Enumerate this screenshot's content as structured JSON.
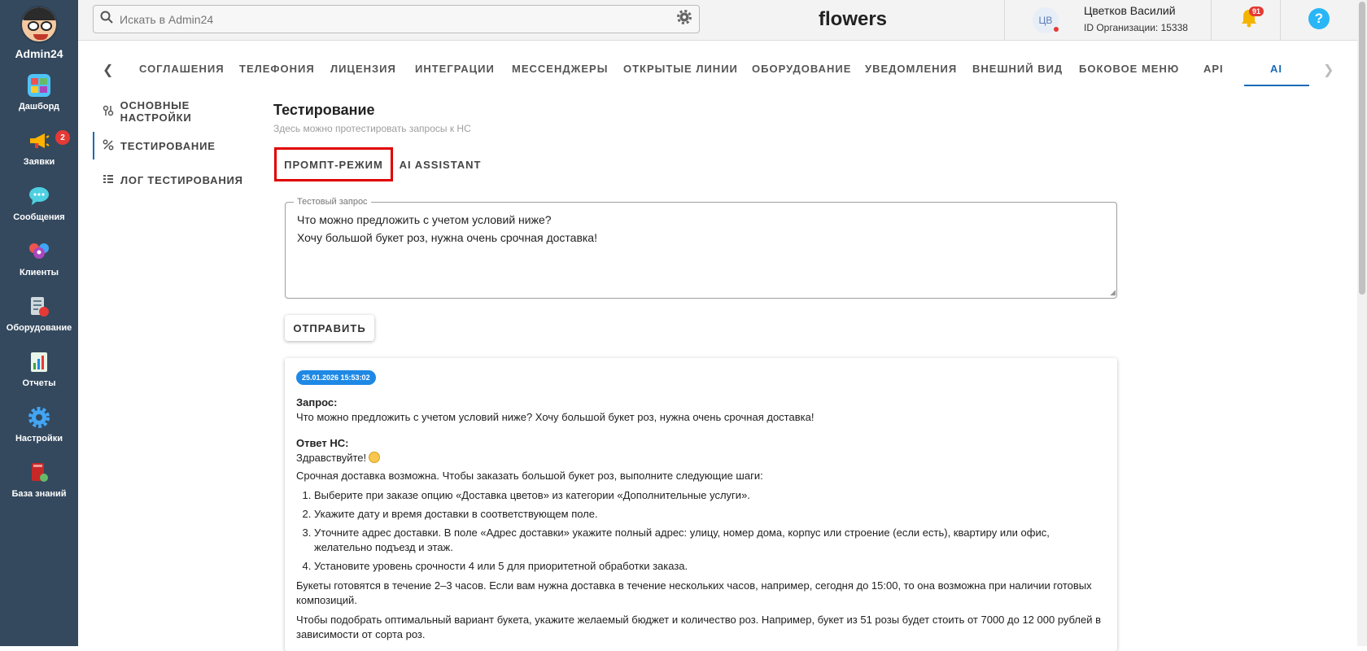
{
  "sidebar": {
    "app_name": "Admin24",
    "items": [
      {
        "label": "Дашборд",
        "icon": "dashboard-icon"
      },
      {
        "label": "Заявки",
        "icon": "megaphone-icon",
        "badge": "2"
      },
      {
        "label": "Сообщения",
        "icon": "chat-icon"
      },
      {
        "label": "Клиенты",
        "icon": "clients-icon"
      },
      {
        "label": "Оборудование",
        "icon": "equipment-icon"
      },
      {
        "label": "Отчеты",
        "icon": "reports-icon"
      },
      {
        "label": "Настройки",
        "icon": "settings-icon"
      },
      {
        "label": "База знаний",
        "icon": "knowledge-base-icon"
      }
    ]
  },
  "topbar": {
    "search_placeholder": "Искать в Admin24",
    "org_name": "flowers",
    "user_initials": "ЦВ",
    "user_name": "Цветков Василий",
    "org_id": "ID Организации: 15338",
    "notifications_count": "91",
    "help_symbol": "?"
  },
  "tabs": {
    "items": [
      "СОГЛАШЕНИЯ",
      "ТЕЛЕФОНИЯ",
      "ЛИЦЕНЗИЯ",
      "ИНТЕГРАЦИИ",
      "МЕССЕНДЖЕРЫ",
      "ОТКРЫТЫЕ ЛИНИИ",
      "ОБОРУДОВАНИЕ",
      "УВЕДОМЛЕНИЯ",
      "ВНЕШНИЙ ВИД",
      "БОКОВОЕ МЕНЮ",
      "API",
      "AI"
    ],
    "active": "AI"
  },
  "submenu": {
    "items": [
      "ОСНОВНЫЕ НАСТРОЙКИ",
      "ТЕСТИРОВАНИЕ",
      "ЛОГ ТЕСТИРОВАНИЯ"
    ],
    "active": "ТЕСТИРОВАНИЕ"
  },
  "main": {
    "title": "Тестирование",
    "subtitle": "Здесь можно протестировать запросы к НС",
    "mode_tabs": [
      "ПРОМПТ-РЕЖИМ",
      "AI ASSISTANT"
    ],
    "field_label": "Тестовый запрос",
    "field_value": "Что можно предложить с учетом условий ниже?\nХочу большой букет роз, нужна очень срочная доставка!",
    "send_label": "ОТПРАВИТЬ"
  },
  "result": {
    "timestamp": "25.01.2026 15:53:02",
    "query_label": "Запрос:",
    "query_text": "Что можно предложить с учетом условий ниже? Хочу большой букет роз, нужна очень срочная доставка!",
    "answer_label": "Ответ НС:",
    "greeting": "Здравствуйте!",
    "intro": "Срочная доставка возможна. Чтобы заказать большой букет роз, выполните следующие шаги:",
    "steps": [
      "Выберите при заказе опцию «Доставка цветов» из категории «Дополнительные услуги».",
      "Укажите дату и время доставки в соответствующем поле.",
      "Уточните адрес доставки. В поле «Адрес доставки» укажите полный адрес: улицу, номер дома, корпус или строение (если есть), квартиру или офис, желательно подъезд и этаж.",
      "Установите уровень срочности 4 или 5 для приоритетной обработки заказа."
    ],
    "para1": "Букеты готовятся в течение 2–3 часов. Если вам нужна доставка в течение нескольких часов, например, сегодня до 15:00, то она возможна при наличии готовых композиций.",
    "para2": "Чтобы подобрать оптимальный вариант букета, укажите желаемый бюджет и количество роз. Например, букет из 51 розы будет стоить от 7000 до 12 000 рублей в зависимости от сорта роз."
  },
  "colors": {
    "sidebar_bg": "#34495e",
    "accent": "#1a6bb5",
    "highlight_border": "#e00000",
    "timestamp_bg": "#1e88e5"
  }
}
